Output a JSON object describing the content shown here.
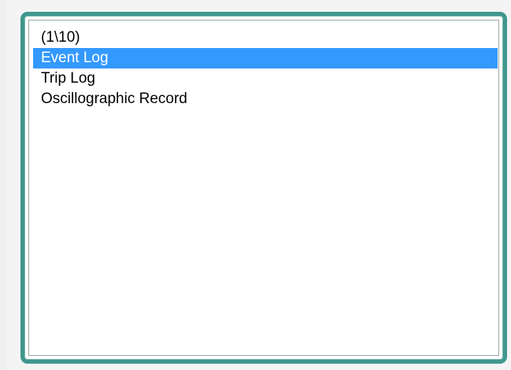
{
  "colors": {
    "frame": "#3f978d",
    "selection": "#3399ff",
    "selection_text": "#ffffff",
    "text": "#000000",
    "background": "#ffffff"
  },
  "listbox": {
    "items": [
      {
        "label": "(1\\10)",
        "selected": false
      },
      {
        "label": "Event Log",
        "selected": true
      },
      {
        "label": "Trip Log",
        "selected": false
      },
      {
        "label": "Oscillographic Record",
        "selected": false
      }
    ]
  }
}
